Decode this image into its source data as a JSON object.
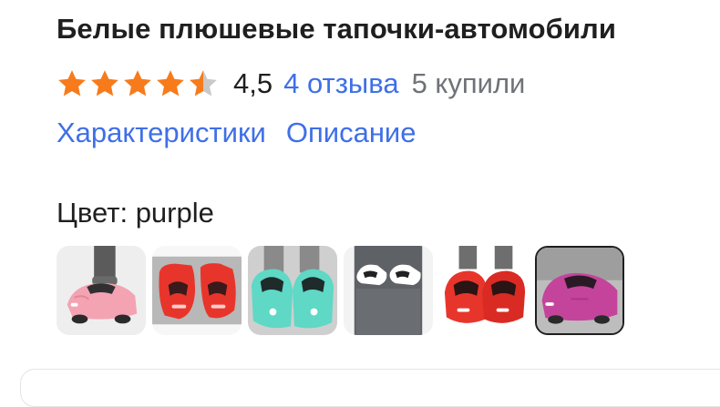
{
  "product": {
    "title": "Белые плюшевые тапочки-автомобили",
    "rating_value": "4,5",
    "rating_stars": 4.5,
    "reviews_label": "4 отзыва",
    "bought_label": "5 купили",
    "star_color": "#f77b1b",
    "star_empty_color": "#c9c9c9",
    "link_color": "#3f6fe8"
  },
  "tabs": [
    {
      "label": "Характеристики"
    },
    {
      "label": "Описание"
    }
  ],
  "color_selector": {
    "label": "Цвет: purple",
    "selected_index": 5,
    "options": [
      {
        "name": "pink",
        "color": "#f4a3b3"
      },
      {
        "name": "red",
        "color": "#e8352c"
      },
      {
        "name": "mint",
        "color": "#5fd8c6"
      },
      {
        "name": "white",
        "color": "#f2f2f2"
      },
      {
        "name": "red",
        "color": "#e8352c"
      },
      {
        "name": "purple",
        "color": "#c4449b"
      }
    ]
  }
}
